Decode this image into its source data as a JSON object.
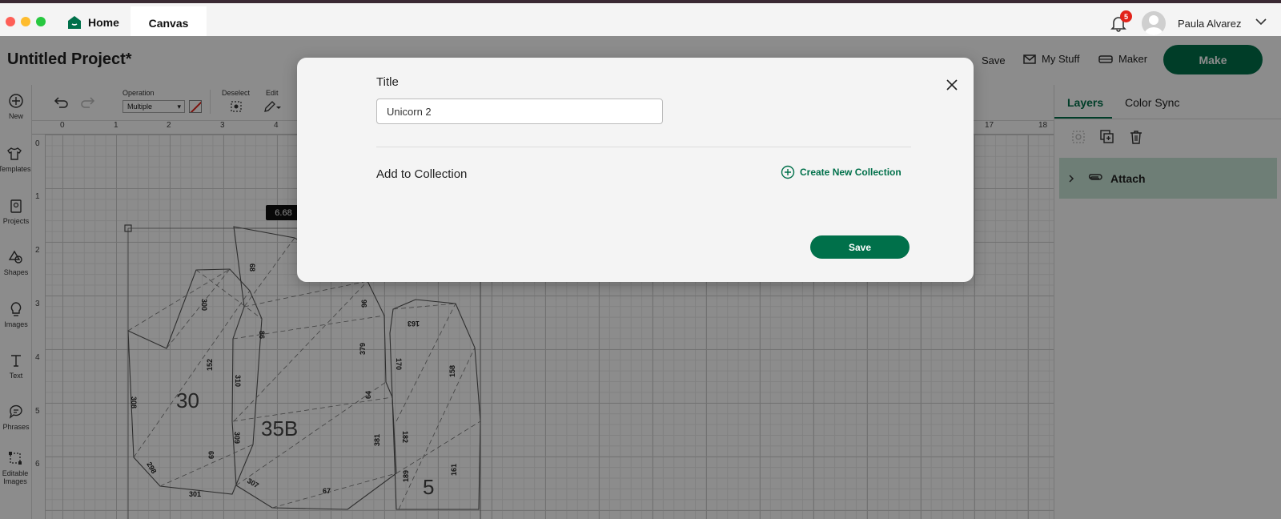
{
  "window": {
    "tabs": [
      {
        "label": "Home"
      },
      {
        "label": "Canvas"
      }
    ],
    "notifications_count": "5",
    "user_name": "Paula Alvarez"
  },
  "header": {
    "project_title": "Untitled Project*",
    "save_label": "Save",
    "mystuff_label": "My Stuff",
    "maker_label": "Maker",
    "make_label": "Make"
  },
  "sidebar": {
    "items": [
      {
        "label": "New",
        "icon": "plus-circle-icon"
      },
      {
        "label": "Templates",
        "icon": "shirt-icon"
      },
      {
        "label": "Projects",
        "icon": "projects-icon"
      },
      {
        "label": "Shapes",
        "icon": "shapes-icon"
      },
      {
        "label": "Images",
        "icon": "lightbulb-icon"
      },
      {
        "label": "Text",
        "icon": "text-icon"
      },
      {
        "label": "Phrases",
        "icon": "speech-bubble-icon"
      },
      {
        "label": "Editable Images",
        "icon": "editable-image-icon"
      }
    ]
  },
  "toolbar": {
    "operation_label": "Operation",
    "operation_value": "Multiple",
    "deselect_label": "Deselect",
    "edit_label": "Edit"
  },
  "canvas": {
    "ruler_top": [
      "0",
      "1",
      "2",
      "3",
      "4",
      "17",
      "18"
    ],
    "ruler_left": [
      "0",
      "1",
      "2",
      "3",
      "4",
      "5",
      "6"
    ],
    "dimension_badge": "6.68",
    "piece_labels": [
      "30",
      "35B",
      "5"
    ],
    "edge_numbers": [
      "68",
      "300",
      "308",
      "152",
      "310",
      "309",
      "298",
      "69",
      "301",
      "307",
      "67",
      "96",
      "379",
      "64",
      "381",
      "163",
      "170",
      "158",
      "182",
      "189",
      "161",
      "86"
    ]
  },
  "right_panel": {
    "tabs": [
      {
        "label": "Layers"
      },
      {
        "label": "Color Sync"
      }
    ],
    "attach_label": "Attach"
  },
  "modal": {
    "title_label": "Title",
    "title_value": "Unicorn 2",
    "collection_label": "Add to Collection",
    "create_collection_label": "Create New Collection",
    "save_label": "Save"
  },
  "colors": {
    "brand_green": "#00704a",
    "attach_bg": "#c8e6d8",
    "badge_red": "#e2231a"
  }
}
